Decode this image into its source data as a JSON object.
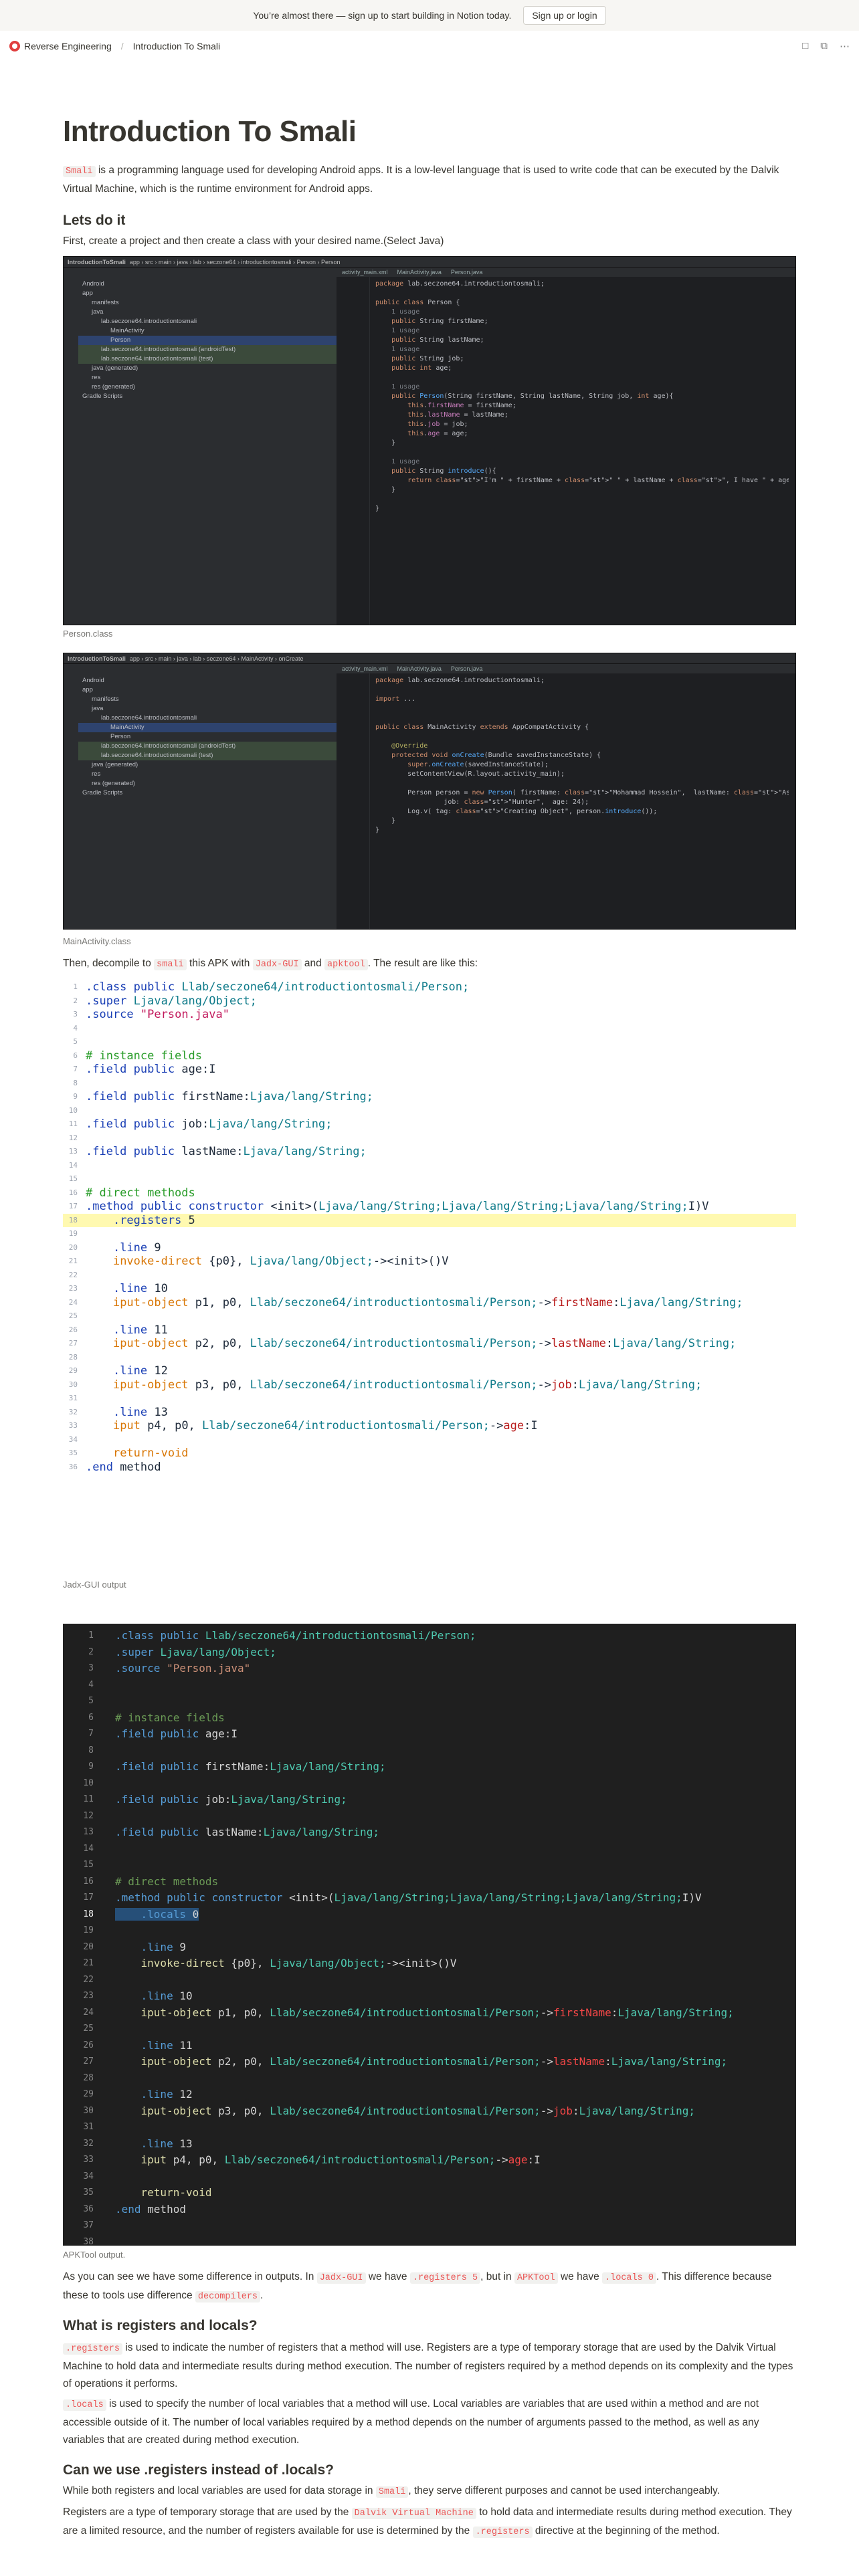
{
  "banner": {
    "text": "You’re almost there — sign up to start building in Notion today.",
    "button": "Sign up or login"
  },
  "breadcrumb": {
    "workspace": "Reverse Engineering",
    "page": "Introduction To Smali"
  },
  "title": "Introduction To Smali",
  "intro": {
    "code": "Smali",
    "text": " is a programming language used for developing Android apps. It is a low-level language that is used to write code that can be executed by the Dalvik Virtual Machine, which is the runtime environment for Android apps."
  },
  "lets_do_it": {
    "heading": "Lets do it",
    "text": "First, create a project and then create a class with your desired name.(Select Java)"
  },
  "ide1": {
    "title": "IntroductionToSmali",
    "path": [
      "app",
      "src",
      "main",
      "java",
      "lab",
      "seczone64",
      "introductiontosmali",
      "Person",
      "Person"
    ],
    "tabs": [
      "activity_main.xml",
      "MainActivity.java",
      "Person.java"
    ],
    "tree": [
      "Android",
      "app",
      "manifests",
      "java",
      "lab.seczone64.introductiontosmali",
      "MainActivity",
      "Person",
      "lab.seczone64.introductiontosmali (androidTest)",
      "lab.seczone64.introductiontosmali (test)",
      "java (generated)",
      "res",
      "res (generated)",
      "Gradle Scripts"
    ],
    "lines": [
      "package lab.seczone64.introductiontosmali;",
      "",
      "public class Person {",
      "    1 usage",
      "    public String firstName;",
      "    1 usage",
      "    public String lastName;",
      "    1 usage",
      "    public String job;",
      "    public int age;",
      "",
      "    1 usage",
      "    public Person(String firstName, String lastName, String job, int age){",
      "        this.firstName = firstName;",
      "        this.lastName = lastName;",
      "        this.job = job;",
      "        this.age = age;",
      "    }",
      "",
      "    1 usage",
      "    public String introduce(){",
      "        return \"I'm \" + firstName + \" \" + lastName + \", I have \" + age + \" years old.\";",
      "    }",
      "",
      "}"
    ]
  },
  "caption1": "Person.class",
  "ide2": {
    "title": "IntroductionToSmali",
    "path": [
      "app",
      "src",
      "main",
      "java",
      "lab",
      "seczone64",
      "MainActivity",
      "onCreate"
    ],
    "tabs": [
      "activity_main.xml",
      "MainActivity.java",
      "Person.java"
    ],
    "tree": [
      "Android",
      "app",
      "manifests",
      "java",
      "lab.seczone64.introductiontosmali",
      "MainActivity",
      "Person",
      "lab.seczone64.introductiontosmali (androidTest)",
      "lab.seczone64.introductiontosmali (test)",
      "java (generated)",
      "res",
      "res (generated)",
      "Gradle Scripts"
    ],
    "lines": [
      "package lab.seczone64.introductiontosmali;",
      "",
      "import ...",
      "",
      "",
      "public class MainActivity extends AppCompatActivity {",
      "",
      "    @Override",
      "    protected void onCreate(Bundle savedInstanceState) {",
      "        super.onCreate(savedInstanceState);",
      "        setContentView(R.layout.activity_main);",
      "",
      "        Person person = new Person( firstName: \"Mohammad Hossein\",  lastName: \"Ashofte Yazdi\",",
      "                 job: \"Hunter\",  age: 24);",
      "        Log.v( tag: \"Creating Object\", person.introduce());",
      "    }",
      "}"
    ]
  },
  "caption2": "MainActivity.class",
  "decompile": {
    "t1": "Then, decompile to ",
    "c1": "smali",
    "t2": " this APK with ",
    "c2": "Jadx-GUI",
    "t3": " and ",
    "c3": "apktool",
    "t4": ". The result are like this:"
  },
  "jadx_lines": [
    ".class public Llab/seczone64/introductiontosmali/Person;",
    ".super Ljava/lang/Object;",
    ".source \"Person.java\"",
    "",
    "",
    "# instance fields",
    ".field public age:I",
    "",
    ".field public firstName:Ljava/lang/String;",
    "",
    ".field public job:Ljava/lang/String;",
    "",
    ".field public lastName:Ljava/lang/String;",
    "",
    "",
    "# direct methods",
    ".method public constructor <init>(Ljava/lang/String;Ljava/lang/String;Ljava/lang/String;I)V",
    "    .registers 5",
    "",
    "    .line 9",
    "    invoke-direct {p0}, Ljava/lang/Object;-><init>()V",
    "",
    "    .line 10",
    "    iput-object p1, p0, Llab/seczone64/introductiontosmali/Person;->firstName:Ljava/lang/String;",
    "",
    "    .line 11",
    "    iput-object p2, p0, Llab/seczone64/introductiontosmali/Person;->lastName:Ljava/lang/String;",
    "",
    "    .line 12",
    "    iput-object p3, p0, Llab/seczone64/introductiontosmali/Person;->job:Ljava/lang/String;",
    "",
    "    .line 13",
    "    iput p4, p0, Llab/seczone64/introductiontosmali/Person;->age:I",
    "",
    "    return-void",
    ".end method"
  ],
  "caption3": "Jadx-GUI output",
  "apktool_lines": [
    ".class public Llab/seczone64/introductiontosmali/Person;",
    ".super Ljava/lang/Object;",
    ".source \"Person.java\"",
    "",
    "",
    "# instance fields",
    ".field public age:I",
    "",
    ".field public firstName:Ljava/lang/String;",
    "",
    ".field public job:Ljava/lang/String;",
    "",
    ".field public lastName:Ljava/lang/String;",
    "",
    "",
    "# direct methods",
    ".method public constructor <init>(Ljava/lang/String;Ljava/lang/String;Ljava/lang/String;I)V",
    "    .locals 0",
    "",
    "    .line 9",
    "    invoke-direct {p0}, Ljava/lang/Object;-><init>()V",
    "",
    "    .line 10",
    "    iput-object p1, p0, Llab/seczone64/introductiontosmali/Person;->firstName:Ljava/lang/String;",
    "",
    "    .line 11",
    "    iput-object p2, p0, Llab/seczone64/introductiontosmali/Person;->lastName:Ljava/lang/String;",
    "",
    "    .line 12",
    "    iput-object p3, p0, Llab/seczone64/introductiontosmali/Person;->job:Ljava/lang/String;",
    "",
    "    .line 13",
    "    iput p4, p0, Llab/seczone64/introductiontosmali/Person;->age:I",
    "",
    "    return-void",
    ".end method",
    "",
    ""
  ],
  "caption4": "APKTool output.",
  "diff": {
    "t1": "As you can see we have some difference in outputs. In ",
    "c1": "Jadx-GUI",
    "t2": " we have ",
    "c2": ".registers 5",
    "t3": ", but in ",
    "c3": "APKTool",
    "t4": " we have ",
    "c4": ".locals 0",
    "t5": ". This difference because these to tools use difference ",
    "c5": "decompilers",
    "t6": "."
  },
  "registers_section": {
    "heading": "What is registers and locals?",
    "c1": ".registers",
    "p1": " is used to indicate the number of registers that a method will use. Registers are a type of temporary storage that are used by the Dalvik Virtual Machine to hold data and intermediate results during method execution. The number of registers required by a method depends on its complexity and the types of operations it performs.",
    "c2": ".locals",
    "p2": " is used to specify the number of local variables that a method will use. Local variables are variables that are used within a method and are not accessible outside of it. The number of local variables required by a method depends on the number of arguments passed to the method, as well as any variables that are created during method execution."
  },
  "instead_section": {
    "heading": "Can we use .registers instead of .locals?",
    "t1": "While both registers and local variables are used for data storage in ",
    "c1": "Smali",
    "t2": ", they serve different purposes and cannot be used interchangeably.",
    "t3": "Registers are a type of temporary storage that are used by the ",
    "c2": "Dalvik Virtual Machine",
    "t4": " to hold data and intermediate results during method execution. They are a limited resource, and the number of registers available for use is determined by the ",
    "c3": ".registers",
    "t5": " directive at the beginning of the method."
  }
}
